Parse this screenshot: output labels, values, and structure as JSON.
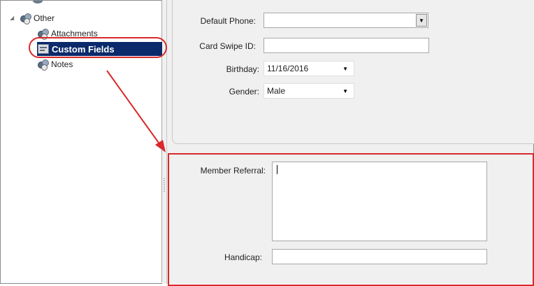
{
  "tree": {
    "group_label": "Other",
    "items": [
      {
        "label": "Attachments"
      },
      {
        "label": "Custom Fields"
      },
      {
        "label": "Notes"
      }
    ]
  },
  "form": {
    "default_phone_label": "Default Phone:",
    "default_phone_value": "",
    "card_swipe_label": "Card Swipe ID:",
    "card_swipe_value": "",
    "birthday_label": "Birthday:",
    "birthday_value": "11/16/2016",
    "gender_label": "Gender:",
    "gender_value": "Male"
  },
  "custom_fields": {
    "member_referral_label": "Member Referral:",
    "member_referral_value": "",
    "handicap_label": "Handicap:",
    "handicap_value": ""
  },
  "colors": {
    "selection": "#0b2a6b",
    "annotation": "#d9292b"
  }
}
